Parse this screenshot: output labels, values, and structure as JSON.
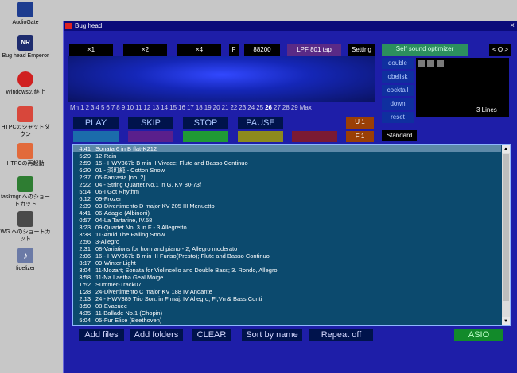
{
  "desktop": {
    "icons": [
      {
        "label": "AudioGate",
        "icon": "audiogate-icon",
        "color": "#1d3c8f"
      },
      {
        "label": "Bug head Emperor",
        "icon": "nr-app-icon",
        "color": "#1e2c6e"
      },
      {
        "label": "Windowsの終止",
        "icon": "stop-icon",
        "color": "#d02020"
      },
      {
        "label": "HTPCのシャットダウン",
        "icon": "shutdown-icon",
        "color": "#d8473b"
      },
      {
        "label": "HTPCの再起動",
        "icon": "restart-icon",
        "color": "#e26a3b"
      },
      {
        "label": "taskmgr へのショートカット",
        "icon": "taskmgr-icon",
        "color": "#2e7d32"
      },
      {
        "label": "WG へのショートカット",
        "icon": "wg-icon",
        "color": "#4a4a4a"
      },
      {
        "label": "fidelizer",
        "icon": "music-note-icon",
        "color": "#6b7aa6"
      }
    ]
  },
  "window": {
    "title": "Bug head",
    "close": "×"
  },
  "topbar": {
    "x1": "×1",
    "x2": "×2",
    "x4": "×4",
    "f": "F",
    "rate": "88200",
    "lpf": "LPF 801 tap",
    "setting": "Setting",
    "optimizer": "Self sound optimizer",
    "nav": "< O >"
  },
  "visualizer": {
    "numbers": [
      "Mn",
      "1",
      "2",
      "3",
      "4",
      "5",
      "6",
      "7",
      "8",
      "9",
      "10",
      "11",
      "12",
      "13",
      "14",
      "15",
      "16",
      "17",
      "18",
      "19",
      "20",
      "21",
      "22",
      "23",
      "24",
      "25",
      "26",
      "27",
      "28",
      "29",
      "Max"
    ],
    "highlighted": "26"
  },
  "side_buttons": [
    "double",
    "obelisk",
    "cocktail",
    "down",
    "reset"
  ],
  "side_panel": {
    "lines": "3 Lines",
    "standard": "Standard"
  },
  "transport": {
    "play": "PLAY",
    "skip": "SKIP",
    "stop": "STOP",
    "pause": "PAUSE",
    "u1": "U 1",
    "f1": "F 1"
  },
  "playlist": [
    {
      "time": "4:41",
      "title": "Sonata 6 in B flat-K212"
    },
    {
      "time": "5:29",
      "title": "12-Rain"
    },
    {
      "time": "2:59",
      "title": "15 - HWV367b B min II Vivace; Flute and Basso Continuo"
    },
    {
      "time": "6:20",
      "title": "01 - 深町純 - Cotton Snow"
    },
    {
      "time": "2:37",
      "title": "05-Fantasia [no. 2]"
    },
    {
      "time": "2:22",
      "title": "04 - String Quartet No.1 in G, KV 80-73f"
    },
    {
      "time": "5:14",
      "title": "06-I Got Rhythm"
    },
    {
      "time": "6:12",
      "title": "09-Frozen"
    },
    {
      "time": "2:39",
      "title": "03-Divertimento D major KV 205 III Menuetto"
    },
    {
      "time": "4:41",
      "title": "06-Adagio (Albinoni)"
    },
    {
      "time": "0:57",
      "title": "04-La Tartarine, IV.58"
    },
    {
      "time": "3:23",
      "title": "09-Quartet No. 3 in F - 3 Allegretto"
    },
    {
      "time": "3:38",
      "title": "11-Amid The Falling Snow"
    },
    {
      "time": "2:56",
      "title": "3-Allegro"
    },
    {
      "time": "2:31",
      "title": "08-Variations for horn and piano - 2, Allegro moderato"
    },
    {
      "time": "2:06",
      "title": "16 - HWV367b B min III Furiso(Presto); Flute and Basso Continuo"
    },
    {
      "time": "3:17",
      "title": "09-Winter Light"
    },
    {
      "time": "3:04",
      "title": "11-Mozart; Sonata for Violincello and Double Bass; 3. Rondo, Allegro"
    },
    {
      "time": "3:58",
      "title": "11-Na Laetha Geal Moige"
    },
    {
      "time": "1:52",
      "title": "Summer-Track07"
    },
    {
      "time": "1:28",
      "title": "24-Divertimento C major KV 188 IV Andante"
    },
    {
      "time": "2:13",
      "title": "24 - HWV389 Trio Son. in F maj. IV Allegro; Fl,Vn & Bass.Conti"
    },
    {
      "time": "3:50",
      "title": "08-Evacuee"
    },
    {
      "time": "4:35",
      "title": "11-Ballade No.1 (Chopin)"
    },
    {
      "time": "5:04",
      "title": "05-Fur Elise (Beethoven)"
    }
  ],
  "bottom_buttons": {
    "add_files": "Add files",
    "add_folders": "Add folders",
    "clear": "CLEAR",
    "sort": "Sort by name",
    "repeat": "Repeat off",
    "asio": "ASIO"
  },
  "colors": {
    "window_bg": "#1e1ea8",
    "accent_green": "#2c8f5e",
    "lpf_purple": "#5a2a86",
    "swatch_teal": "#1b6cab",
    "swatch_purple": "#5a1f8c",
    "swatch_green": "#1f9a35",
    "swatch_olive": "#8d8a1c",
    "swatch_maroon": "#7a1a33",
    "u1_bg": "#9a3f06",
    "asio_green": "#128a2a"
  }
}
